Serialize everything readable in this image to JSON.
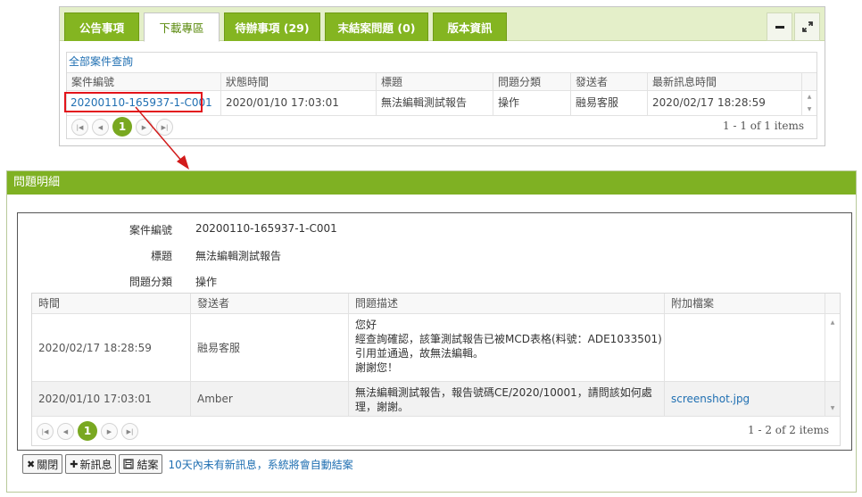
{
  "tabs": [
    {
      "label": "公告事項"
    },
    {
      "label": "下載專區"
    },
    {
      "label": "待辦事項 (29)"
    },
    {
      "label": "末結案問題 (0)"
    },
    {
      "label": "版本資訊"
    }
  ],
  "window_controls": {
    "minimize_icon": "minus-icon",
    "expand_icon": "expand-icon"
  },
  "top_grid": {
    "toolbar_link": "全部案件查詢",
    "columns": [
      "案件編號",
      "狀態時間",
      "標題",
      "問題分類",
      "發送者",
      "最新訊息時間"
    ],
    "row": {
      "case_id": "20200110-165937-1-C001",
      "status_time": "2020/01/10 17:03:01",
      "title": "無法編輯測試報告",
      "category": "操作",
      "sender": "融易客服",
      "latest_time": "2020/02/17 18:28:59"
    },
    "pager": {
      "current": "1",
      "info": "1 - 1 of 1 items"
    }
  },
  "detail": {
    "title": "問題明細",
    "fields": {
      "case_label": "案件編號",
      "case_value": "20200110-165937-1-C001",
      "title_label": "標題",
      "title_value": "無法編輯測試報告",
      "category_label": "問題分類",
      "category_value": "操作"
    },
    "grid": {
      "columns": [
        "時間",
        "發送者",
        "問題描述",
        "附加檔案"
      ],
      "rows": [
        {
          "time": "2020/02/17 18:28:59",
          "sender": "融易客服",
          "desc": [
            "您好",
            "經查詢確認，該筆測試報告已被MCD表格(料號：ADE1033501)",
            "引用並通過，故無法編輯。",
            "謝謝您！"
          ],
          "file": ""
        },
        {
          "time": "2020/01/10 17:03:01",
          "sender": "Amber",
          "desc": [
            "無法編輯測試報告，報告號碼CE/2020/10001，請問該如何處",
            "理，謝謝。"
          ],
          "file": "screenshot.jpg"
        }
      ],
      "pager": {
        "current": "1",
        "info": "1 - 2 of 2 items"
      }
    },
    "buttons": {
      "close": "關閉",
      "new_message": "新訊息",
      "close_case": "結案"
    },
    "note": "10天內未有新訊息，系統將會自動結案"
  }
}
